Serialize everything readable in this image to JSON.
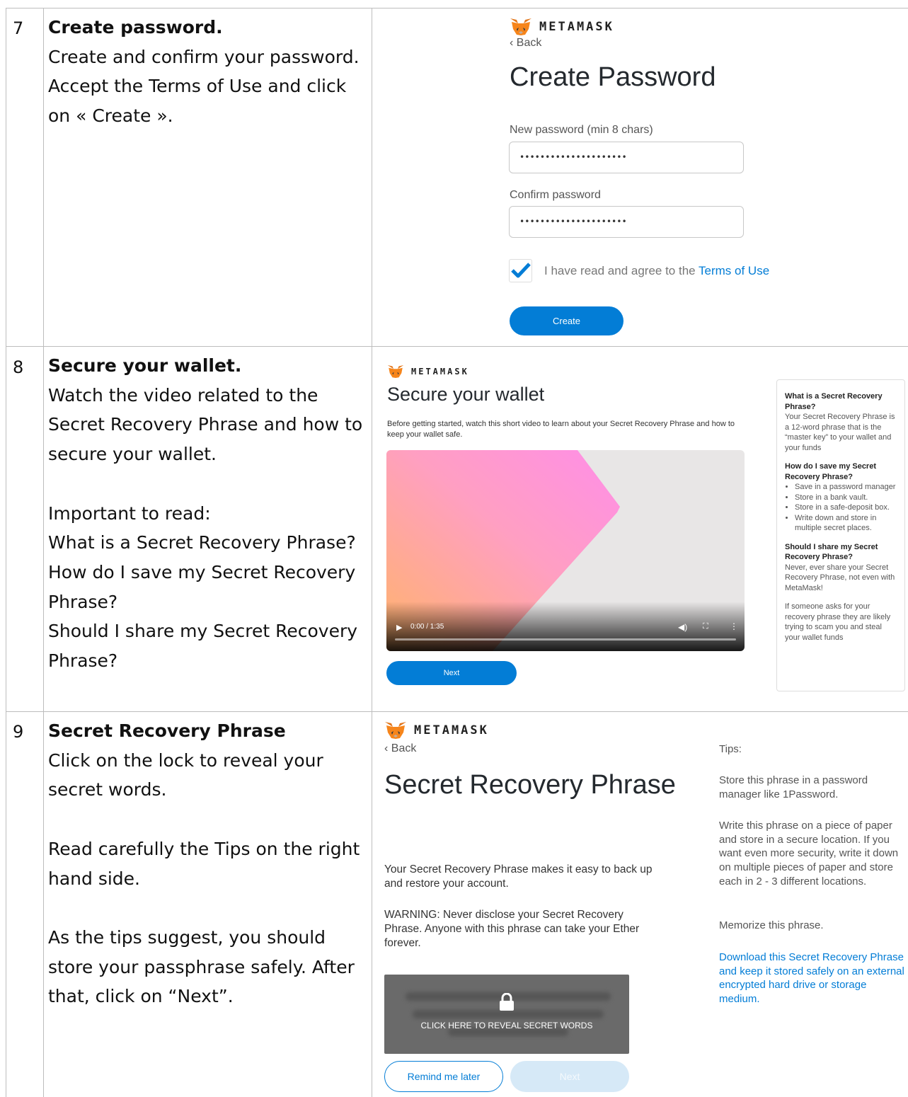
{
  "rows": [
    {
      "number": "7",
      "title": "Create password.",
      "lines": [
        "Create and confirm your password.",
        "Accept the Terms of Use and click",
        "on « Create »."
      ]
    },
    {
      "number": "8",
      "title": "Secure your wallet.",
      "lines": [
        "Watch the video related to the",
        "Secret Recovery Phrase and how to",
        "secure your wallet.",
        "",
        "Important to read:",
        "What is a Secret Recovery Phrase?",
        "How do I save my Secret Recovery",
        "Phrase?",
        "Should I share my Secret Recovery",
        "Phrase?"
      ]
    },
    {
      "number": "9",
      "title": "Secret Recovery Phrase",
      "lines": [
        "Click on the lock to reveal your",
        "secret words.",
        "",
        "Read carefully the Tips on the right",
        "hand side.",
        "",
        "As the tips suggest, you should",
        "store your passphrase safely. After",
        "that, click on “Next”."
      ]
    }
  ],
  "brand": "METAMASK",
  "create_password": {
    "back": "‹ Back",
    "title": "Create Password",
    "new_label": "New password (min 8 chars)",
    "new_value": "•••••••••••••••••••••",
    "confirm_label": "Confirm password",
    "confirm_value": "•••••••••••••••••••••",
    "agree_text": "I have read and agree to the ",
    "terms_link": "Terms of Use",
    "create_button": "Create",
    "checked": true
  },
  "secure_wallet": {
    "title": "Secure your wallet",
    "subtitle": "Before getting started, watch this short video to learn about your Secret Recovery Phrase and how to keep your wallet safe.",
    "video_time": "0:00 / 1:35",
    "next_button": "Next",
    "side": {
      "q1": "What is a Secret Recovery Phrase?",
      "a1": "Your Secret Recovery Phrase is a 12-word phrase that is the “master key” to your wallet and your funds",
      "q2": "How do I save my Secret Recovery Phrase?",
      "tips": [
        "Save in a password manager",
        "Store in a bank vault.",
        "Store in a safe-deposit box.",
        "Write down and store in multiple secret places."
      ],
      "q3": "Should I share my Secret Recovery Phrase?",
      "a3": "Never, ever share your Secret Recovery Phrase, not even with MetaMask!",
      "a4": "If someone asks for your recovery phrase they are likely trying to scam you and steal your wallet funds"
    }
  },
  "secret_phrase": {
    "back": "‹ Back",
    "title": "Secret Recovery Phrase",
    "para1": "Your Secret Recovery Phrase makes it easy to back up and restore your account.",
    "para2": "WARNING: Never disclose your Secret Recovery Phrase. Anyone with this phrase can take your Ether forever.",
    "reveal_text": "CLICK HERE TO REVEAL SECRET WORDS",
    "remind_button": "Remind me later",
    "next_button": "Next",
    "tips_label": "Tips:",
    "tip1": "Store this phrase in a password manager like 1Password.",
    "tip2": "Write this phrase on a piece of paper and store in a secure location. If you want even more security, write it down on multiple pieces of paper and store each in 2 - 3 different locations.",
    "tip3": "Memorize this phrase.",
    "download_link": "Download this Secret Recovery Phrase and keep it stored safely on an external encrypted hard drive or storage medium."
  },
  "colors": {
    "accent": "#037dd6",
    "grid": "#bdbdbd",
    "fox": "#e2761b"
  },
  "icons": [
    "metamask-fox-icon",
    "checkmark-icon",
    "play-icon",
    "volume-icon",
    "fullscreen-icon",
    "more-options-icon",
    "lock-icon"
  ]
}
